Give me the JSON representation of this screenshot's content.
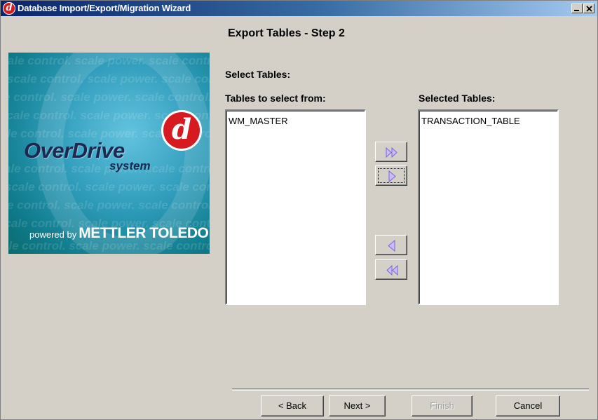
{
  "window": {
    "title": "Database Import/Export/Migration Wizard",
    "icon": "overdrive-d-icon",
    "controls": {
      "minimize": "minimize-icon",
      "close": "close-icon"
    }
  },
  "step_title": "Export Tables - Step 2",
  "logo": {
    "brand": "OverDrive",
    "brand_sub": "system",
    "powered_by": "powered by",
    "company": "METTLER TOLEDO",
    "watermark": "scale control. scale power. scale control. scale power.",
    "colors": {
      "red": "#d71920",
      "teal": "#2e9bb9",
      "navy": "#1c2a52"
    }
  },
  "select_tables_label": "Select Tables:",
  "source": {
    "label": "Tables to select from:",
    "items": [
      "WM_MASTER"
    ]
  },
  "target": {
    "label": "Selected Tables:",
    "items": [
      "TRANSACTION_TABLE"
    ]
  },
  "move_buttons": {
    "add_all": "double-right-arrow-icon",
    "add_one": "right-arrow-icon",
    "remove_one": "left-arrow-icon",
    "remove_all": "double-left-arrow-icon",
    "arrow_color": "#9a86e8"
  },
  "buttons": {
    "back": "< Back",
    "next": "Next >",
    "finish": "Finish",
    "cancel": "Cancel"
  }
}
